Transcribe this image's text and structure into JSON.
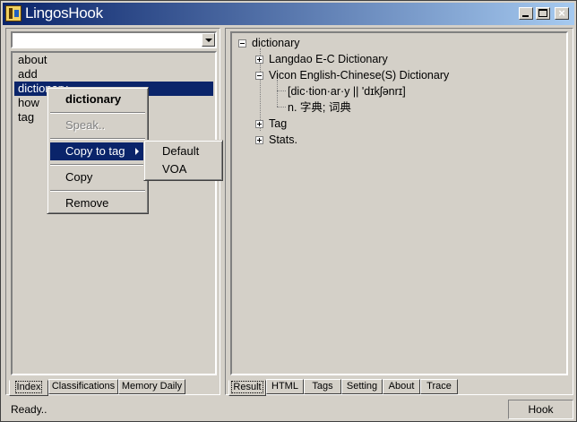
{
  "window": {
    "title": "LingosHook",
    "icons": {
      "app": "lingoshook-app-icon",
      "minimize": "minimize-icon",
      "maximize": "maximize-icon",
      "close": "close-icon"
    }
  },
  "left_panel": {
    "search": {
      "value": ""
    },
    "words": [
      "about",
      "add",
      "dictionary",
      "how",
      "tag"
    ],
    "selected_word": "dictionary",
    "tabs": [
      "Index",
      "Classifications",
      "Memory Daily"
    ],
    "active_tab": "Index"
  },
  "context_menu": {
    "title": "dictionary",
    "speak": "Speak..",
    "copy_to_tag": "Copy to tag",
    "copy": "Copy",
    "remove": "Remove",
    "submenu": [
      "Default",
      "VOA"
    ]
  },
  "tree": {
    "root": "dictionary",
    "children": [
      "Langdao E-C Dictionary",
      "Vicon English-Chinese(S) Dictionary",
      "Tag",
      "Stats."
    ],
    "vicon_entries": [
      "[dic·tion·ar·y || 'dɪkʃənrɪ]",
      "n. 字典; 词典"
    ]
  },
  "right_tabs": [
    "Result",
    "HTML",
    "Tags",
    "Setting",
    "About",
    "Trace"
  ],
  "active_right_tab": "Result",
  "status": {
    "text": "Ready..",
    "hook_label": "Hook"
  }
}
